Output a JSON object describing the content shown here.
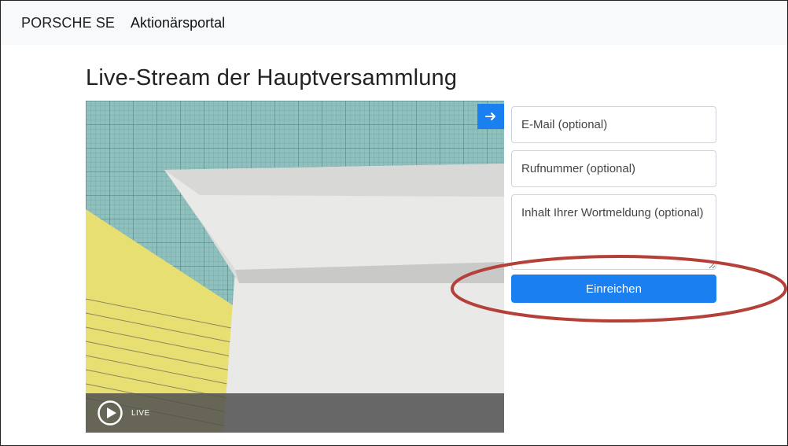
{
  "navbar": {
    "brand": "PORSCHE SE",
    "link": "Aktionärsportal"
  },
  "page": {
    "title": "Live-Stream der Hauptversammlung"
  },
  "video": {
    "live_label": "LIVE",
    "expand_icon": "arrow-right-icon",
    "play_icon": "play-circle-icon"
  },
  "form": {
    "email_placeholder": "E-Mail (optional)",
    "phone_placeholder": "Rufnummer (optional)",
    "message_placeholder": "Inhalt Ihrer Wortmeldung (optional)",
    "submit_label": "Einreichen"
  },
  "colors": {
    "accent": "#1a7ff0",
    "navbar_bg": "#f8f9fa",
    "highlight": "#b5403a"
  }
}
